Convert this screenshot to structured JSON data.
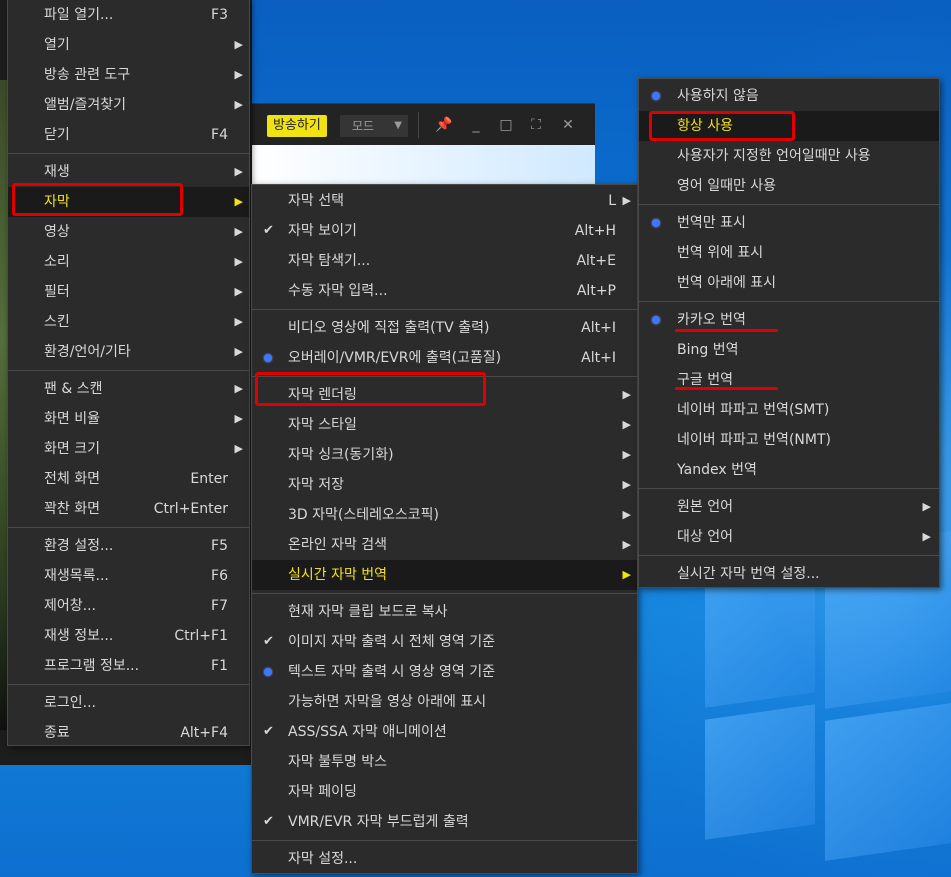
{
  "player": {
    "broadcast_label": "방송하기",
    "mode_label": "모드"
  },
  "main_menu": {
    "items": [
      {
        "label": "파일 열기...",
        "shortcut": "F3"
      },
      {
        "label": "열기"
      },
      {
        "label": "방송 관련 도구"
      },
      {
        "label": "앨범/즐겨찾기"
      },
      {
        "label": "닫기",
        "shortcut": "F4"
      },
      {
        "label": "재생"
      },
      {
        "label": "자막"
      },
      {
        "label": "영상"
      },
      {
        "label": "소리"
      },
      {
        "label": "필터"
      },
      {
        "label": "스킨"
      },
      {
        "label": "환경/언어/기타"
      },
      {
        "label": "팬 & 스캔"
      },
      {
        "label": "화면 비율"
      },
      {
        "label": "화면 크기"
      },
      {
        "label": "전체 화면",
        "shortcut": "Enter"
      },
      {
        "label": "꽉찬 화면",
        "shortcut": "Ctrl+Enter"
      },
      {
        "label": "환경 설정...",
        "shortcut": "F5"
      },
      {
        "label": "재생목록...",
        "shortcut": "F6"
      },
      {
        "label": "제어창...",
        "shortcut": "F7"
      },
      {
        "label": "재생 정보...",
        "shortcut": "Ctrl+F1"
      },
      {
        "label": "프로그램 정보...",
        "shortcut": "F1"
      },
      {
        "label": "로그인..."
      },
      {
        "label": "종료",
        "shortcut": "Alt+F4"
      }
    ]
  },
  "subtitle_menu": {
    "items": [
      {
        "label": "자막 선택",
        "shortcut": "L"
      },
      {
        "label": "자막 보이기",
        "shortcut": "Alt+H",
        "checked": true
      },
      {
        "label": "자막 탐색기...",
        "shortcut": "Alt+E"
      },
      {
        "label": "수동 자막 입력...",
        "shortcut": "Alt+P"
      },
      {
        "label": "비디오 영상에 직접 출력(TV 출력)",
        "shortcut": "Alt+I"
      },
      {
        "label": "오버레이/VMR/EVR에 출력(고품질)",
        "shortcut": "Alt+I",
        "selected": true
      },
      {
        "label": "자막 렌더링"
      },
      {
        "label": "자막 스타일"
      },
      {
        "label": "자막 싱크(동기화)"
      },
      {
        "label": "자막 저장"
      },
      {
        "label": "3D 자막(스테레오스코픽)"
      },
      {
        "label": "온라인 자막 검색"
      },
      {
        "label": "실시간 자막 번역"
      },
      {
        "label": "현재 자막 클립 보드로 복사"
      },
      {
        "label": "이미지 자막 출력 시 전체 영역 기준",
        "checked": true
      },
      {
        "label": "텍스트 자막 출력 시 영상 영역 기준",
        "selected": true
      },
      {
        "label": "가능하면 자막을 영상 아래에 표시"
      },
      {
        "label": "ASS/SSA 자막 애니메이션",
        "checked": true
      },
      {
        "label": "자막 불투명 박스"
      },
      {
        "label": "자막 페이딩"
      },
      {
        "label": "VMR/EVR 자막 부드럽게 출력",
        "checked": true
      },
      {
        "label": "자막 설정..."
      }
    ]
  },
  "translate_menu": {
    "items": [
      {
        "label": "사용하지 않음",
        "selected": true
      },
      {
        "label": "항상 사용"
      },
      {
        "label": "사용자가 지정한 언어일때만 사용"
      },
      {
        "label": "영어 일때만 사용"
      },
      {
        "label": "번역만 표시",
        "selected": true
      },
      {
        "label": "번역 위에 표시"
      },
      {
        "label": "번역 아래에 표시"
      },
      {
        "label": "카카오 번역",
        "selected": true
      },
      {
        "label": "Bing 번역"
      },
      {
        "label": "구글 번역"
      },
      {
        "label": "네이버 파파고 번역(SMT)"
      },
      {
        "label": "네이버 파파고 번역(NMT)"
      },
      {
        "label": "Yandex 번역"
      },
      {
        "label": "원본 언어"
      },
      {
        "label": "대상 언어"
      },
      {
        "label": "실시간 자막 번역 설정..."
      }
    ]
  },
  "colors": {
    "menu_bg": "#2b2b2b",
    "active_text": "#f1e214",
    "highlight": "#e10000",
    "radio": "#3d78ff"
  }
}
